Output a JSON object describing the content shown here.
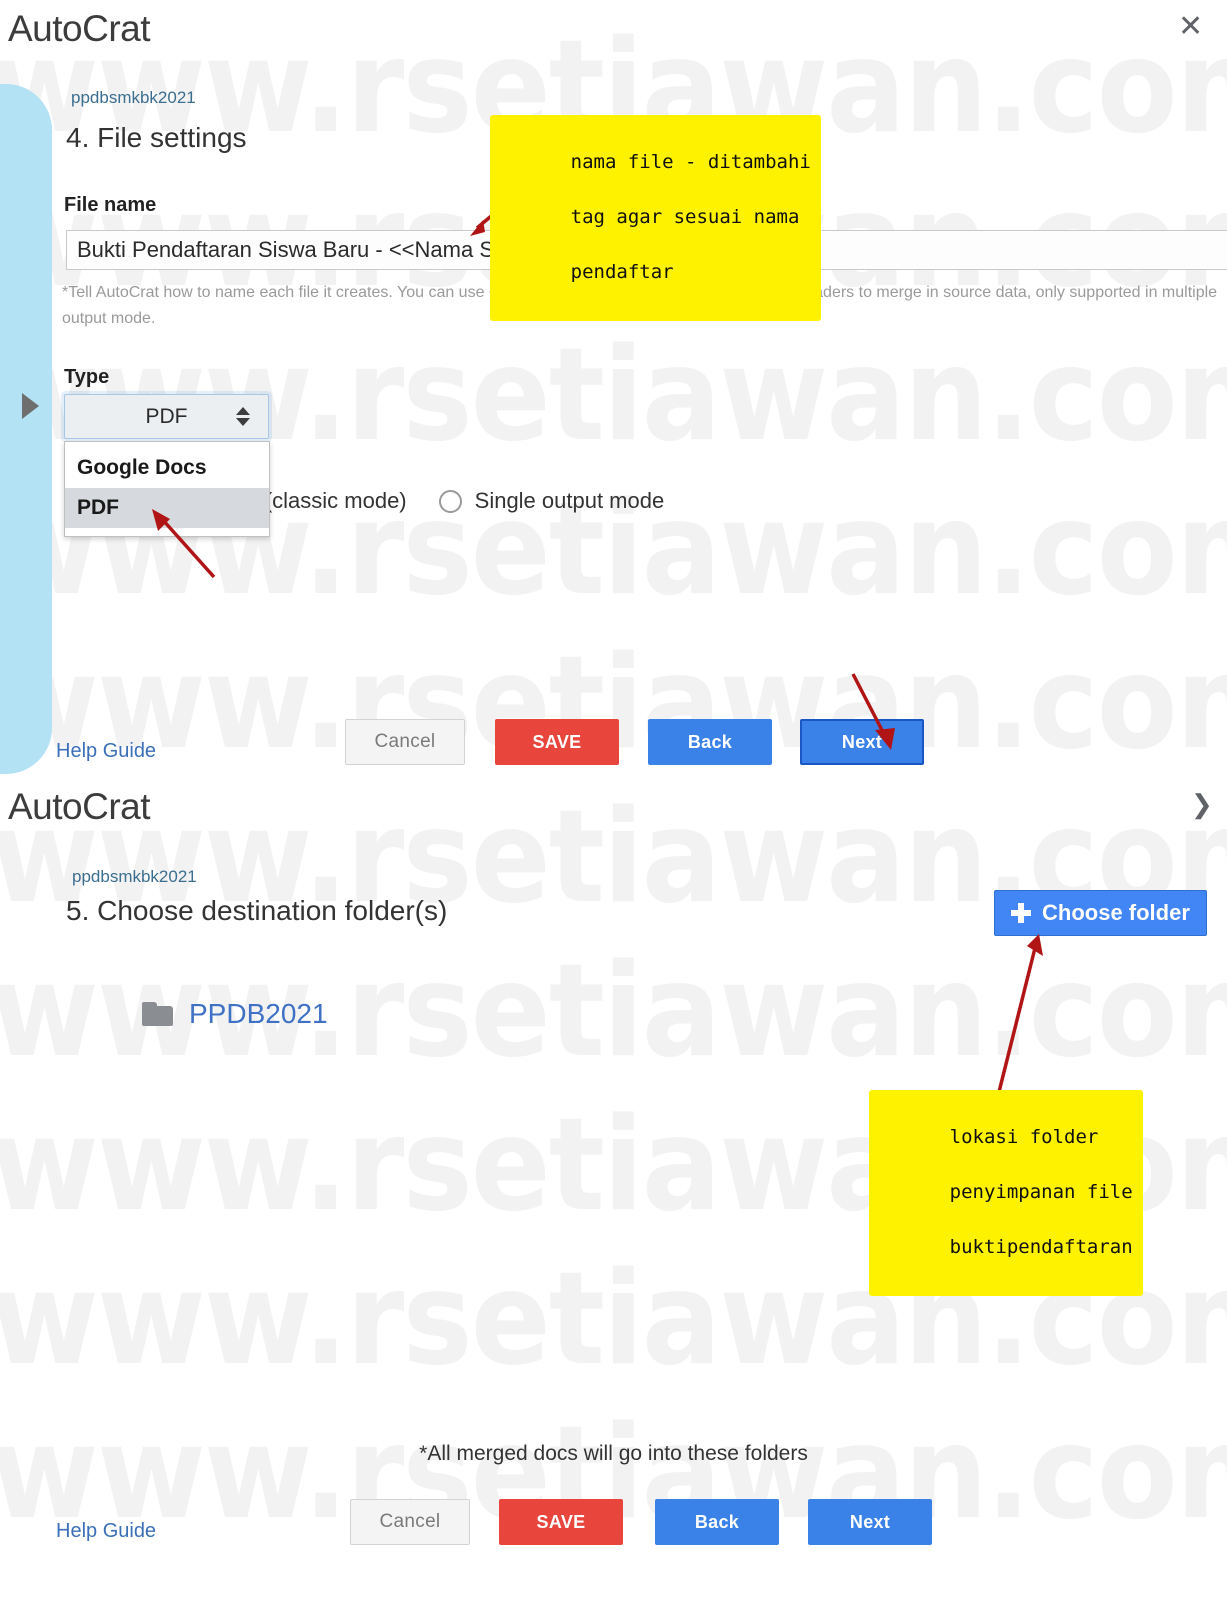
{
  "watermark": {
    "text": "www.rsetiawan.com"
  },
  "panel_top": {
    "app_title": "AutoCrat",
    "close_icon": "close-icon",
    "breadcrumb": "ppdbsmkbk2021",
    "step_heading": "4. File settings",
    "file_name": {
      "label": "File name",
      "value": "Bukti Pendaftaran Siswa Baru - <<Nama Siswa>>",
      "placeholder": "File name",
      "helper": "*Tell AutoCrat how to name each file it creates. You can use <<TAGS>> aligned to merge sheet column headers to merge in source data, only supported in multiple output mode."
    },
    "type": {
      "label": "Type",
      "selected": "PDF",
      "options": [
        "Google Docs",
        "PDF"
      ],
      "highlighted": "PDF"
    },
    "output_mode": {
      "multiple_label": "ode (classic mode)",
      "single_label": "Single output mode"
    },
    "help_guide": "Help Guide",
    "buttons": {
      "cancel": "Cancel",
      "save": "SAVE",
      "back": "Back",
      "next": "Next"
    },
    "annotation": {
      "line1": "nama file - ditambahi",
      "line2": "tag agar sesuai nama",
      "line3": "pendaftar"
    }
  },
  "panel_bottom": {
    "app_title": "AutoCrat",
    "chevron_icon": "chevron-right-icon",
    "breadcrumb": "ppdbsmkbk2021",
    "step_heading": "5. Choose destination folder(s)",
    "choose_folder_label": "Choose folder",
    "folders": [
      {
        "name": "PPDB2021"
      }
    ],
    "footer_note": "*All merged docs will go into these folders",
    "help_guide": "Help Guide",
    "buttons": {
      "cancel": "Cancel",
      "save": "SAVE",
      "back": "Back",
      "next": "Next"
    },
    "annotation": {
      "line1": "lokasi folder",
      "line2": "penyimpanan file",
      "line3": "buktipendaftaran"
    }
  },
  "colors": {
    "save_red": "#e8453c",
    "blue": "#3b82e8",
    "choose_folder_blue": "#4285f4",
    "annotation_yellow": "#fff200",
    "arrow_red": "#b01414",
    "rail_blue": "#b3e2f5",
    "link_blue": "#3b6fb8"
  }
}
